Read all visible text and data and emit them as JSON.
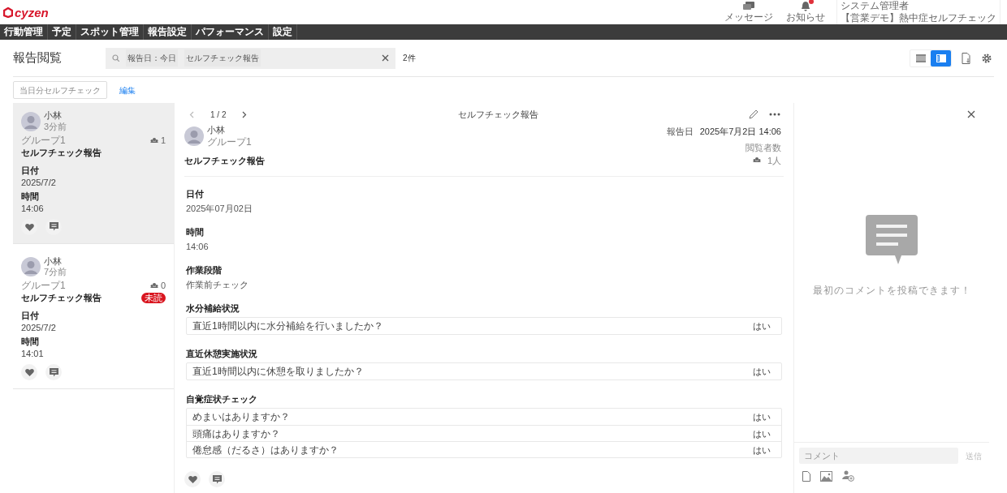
{
  "header": {
    "logo": "cyzen",
    "messages_label": "メッセージ",
    "notices_label": "お知らせ",
    "notice_unread": true,
    "user_role": "システム管理者",
    "user_org": "【営業デモ】熱中症セルフチェック"
  },
  "nav": [
    {
      "label": "行動管理"
    },
    {
      "label": "予定"
    },
    {
      "label": "スポット管理"
    },
    {
      "label": "報告設定"
    },
    {
      "label": "パフォーマンス"
    },
    {
      "label": "設定"
    }
  ],
  "page_title": "報告閲覧",
  "search": {
    "chips": [
      "報告日：今日",
      "セルフチェック報告"
    ]
  },
  "result_count": "2件",
  "view_modes": [
    {
      "kind": "list",
      "selected": false
    },
    {
      "kind": "detail",
      "selected": true
    }
  ],
  "filter": {
    "chip": "当日分セルフチェック",
    "edit_link": "編集"
  },
  "reports": [
    {
      "author": "小林",
      "ago": "3分前",
      "group": "グループ1",
      "readers": "1",
      "title": "セルフチェック報告",
      "selected": true,
      "fields": [
        {
          "label": "日付",
          "value": "2025/7/2"
        },
        {
          "label": "時間",
          "value": "14:06"
        }
      ]
    },
    {
      "author": "小林",
      "ago": "7分前",
      "group": "グループ1",
      "readers": "0",
      "title": "セルフチェック報告",
      "badge": "未読",
      "selected": false,
      "fields": [
        {
          "label": "日付",
          "value": "2025/7/2"
        },
        {
          "label": "時間",
          "value": "14:01"
        }
      ]
    }
  ],
  "detail": {
    "pager": "1 / 2",
    "heading": "セルフチェック報告",
    "author": "小林",
    "group": "グループ1",
    "title": "セルフチェック報告",
    "report_date_label": "報告日",
    "report_date": "2025年7月2日 14:06",
    "readers_label": "閲覧者数",
    "readers": "1人",
    "fields": [
      {
        "kind": "text",
        "label": "日付",
        "value": "2025年07月02日"
      },
      {
        "kind": "text",
        "label": "時間",
        "value": "14:06"
      },
      {
        "kind": "text",
        "label": "作業段階",
        "value": "作業前チェック"
      },
      {
        "kind": "table",
        "label": "水分補給状況",
        "rows": [
          {
            "question": "直近1時間以内に水分補給を行いましたか？",
            "answer": "はい"
          }
        ]
      },
      {
        "kind": "table",
        "label": "直近休憩実施状況",
        "rows": [
          {
            "question": "直近1時間以内に休憩を取りましたか？",
            "answer": "はい"
          }
        ]
      },
      {
        "kind": "table",
        "label": "自覚症状チェック",
        "rows": [
          {
            "question": "めまいはありますか？",
            "answer": "はい"
          },
          {
            "question": "頭痛はありますか？",
            "answer": "はい"
          },
          {
            "question": "倦怠感（だるさ）はありますか？",
            "answer": "はい"
          }
        ]
      }
    ]
  },
  "comments": {
    "empty_text": "最初のコメントを投稿できます！",
    "placeholder": "コメント",
    "send": "送信"
  }
}
